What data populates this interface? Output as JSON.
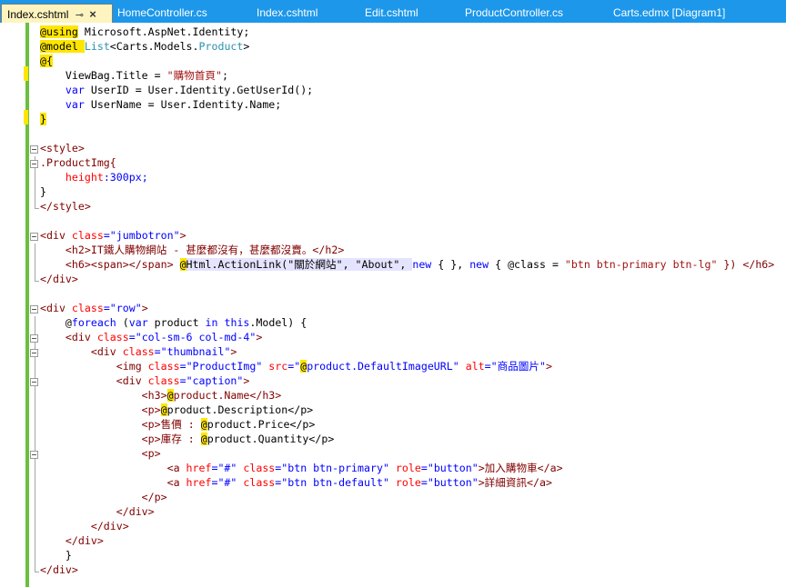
{
  "tabs": [
    {
      "label": "Index.cshtml",
      "active": true
    },
    {
      "label": "HomeController.cs"
    },
    {
      "label": "Index.cshtml"
    },
    {
      "label": "Edit.cshtml"
    },
    {
      "label": "ProductController.cs"
    },
    {
      "label": "Carts.edmx [Diagram1]"
    }
  ],
  "tab_icons": {
    "pin": "pin-icon",
    "close": "close-icon",
    "pin_glyph": "⊸",
    "close_glyph": "×"
  },
  "colors": {
    "tab_bar": "#1c97ea",
    "active_tab": "#fdf4bf",
    "change_bar": "#6bbf3e",
    "razor": "#ffe600"
  },
  "code": {
    "using_kw": "@using",
    "using_ns": " Microsoft.AspNet.Identity;",
    "model_kw": "@model",
    "model_list": "List",
    "model_mid": "<Carts.Models.",
    "model_product": "Product",
    "model_end": ">",
    "block_open": "@{",
    "vb": "    ViewBag.Title = ",
    "vb_str": "\"購物首頁\"",
    "semi": ";",
    "var1_kw": "    var",
    "var1": " UserID = User.Identity.GetUserId();",
    "var2_kw": "    var",
    "var2": " UserName = User.Identity.Name;",
    "block_close": "}",
    "style_open": "<style>",
    "css_sel": ".ProductImg{",
    "css_prop": "    height",
    "css_val": ":300px;",
    "css_close": "}",
    "style_close": "</style>",
    "div_lt": "<div ",
    "div_class": "class",
    "eq": "=",
    "jumbo": "\"jumbotron\"",
    "gt": ">",
    "h2": "    <h2>IT鐵人購物網站 - 甚麼都沒有，甚麼都沒賣。</h2>",
    "h6_a": "    <h6><span></span> ",
    "h6_at": "@",
    "h6_b": "Html.ActionLink(\"關於網站\", \"About\", ",
    "h6_new1": "new",
    "h6_c": " { }, ",
    "h6_new2": "new",
    "h6_d": " { @class = ",
    "h6_str": "\"btn btn-primary btn-lg\"",
    "h6_e": " }) </h6>",
    "div_close": "</div>",
    "row": "\"row\"",
    "foreach_at": "    @",
    "foreach_kw": "foreach",
    "foreach_a": " (",
    "foreach_var": "var",
    "foreach_b": " product ",
    "foreach_in": "in",
    "foreach_sp": " ",
    "foreach_this": "this",
    "foreach_c": ".Model) {",
    "col_a": "    <div ",
    "col_str": "\"col-sm-6 col-md-4\"",
    "thumb_a": "        <div ",
    "thumb_str": "\"thumbnail\"",
    "img_a": "            <img ",
    "img_class_str": "\"ProductImg\"",
    "img_src": " src",
    "img_q": "\"",
    "img_at": "@",
    "img_val": "product.DefaultImageURL\"",
    "img_alt": " alt",
    "img_alt_str": "\"商品圖片\"",
    "img_end": ">",
    "cap_a": "            <div ",
    "cap_str": "\"caption\"",
    "h3_a": "                <h3>",
    "h3_b": "product.Name</h3>",
    "p1_a": "                <p>",
    "p1_b": "product.Description</p>",
    "p2_a": "                <p>售價 : ",
    "p2_b": "product.Price</p>",
    "p3_a": "                <p>庫存 : ",
    "p3_b": "product.Quantity</p>",
    "p4": "                <p>",
    "a1_a": "                    <a ",
    "href": "href",
    "hash": "\"#\"",
    "a_class": " class",
    "btn1": "\"btn btn-primary\"",
    "role": " role",
    "button_str": "\"button\"",
    "a1_text": ">加入購物車</a>",
    "btn2": "\"btn btn-default\"",
    "a2_text": ">詳細資訊</a>",
    "p_close": "                </p>",
    "div_c1": "            </div>",
    "div_c2": "        </div>",
    "div_c3": "    </div>",
    "brace": "    }",
    "div_c4": "</div>"
  }
}
